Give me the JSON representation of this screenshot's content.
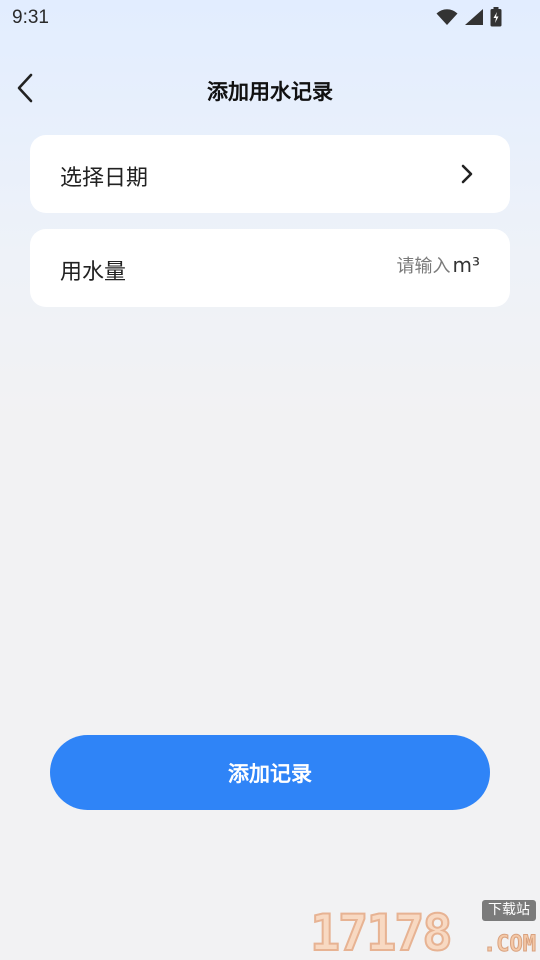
{
  "status_bar": {
    "time": "9:31",
    "icons": [
      "wifi-icon",
      "cellular-signal-icon",
      "battery-charging-icon"
    ]
  },
  "header": {
    "title": "添加用水记录",
    "back_icon": "chevron-left-icon"
  },
  "form": {
    "date_row": {
      "label": "选择日期",
      "icon": "chevron-right-icon"
    },
    "water_row": {
      "label": "用水量",
      "value": "",
      "placeholder": "请输入",
      "unit": "m³"
    }
  },
  "submit": {
    "label": "添加记录"
  },
  "colors": {
    "accent": "#2f84f7",
    "card_bg": "#ffffff",
    "page_bg": "#f2f2f3"
  },
  "watermark": {
    "digits": "17178",
    "domain": ".COM",
    "tag": "下载站"
  }
}
